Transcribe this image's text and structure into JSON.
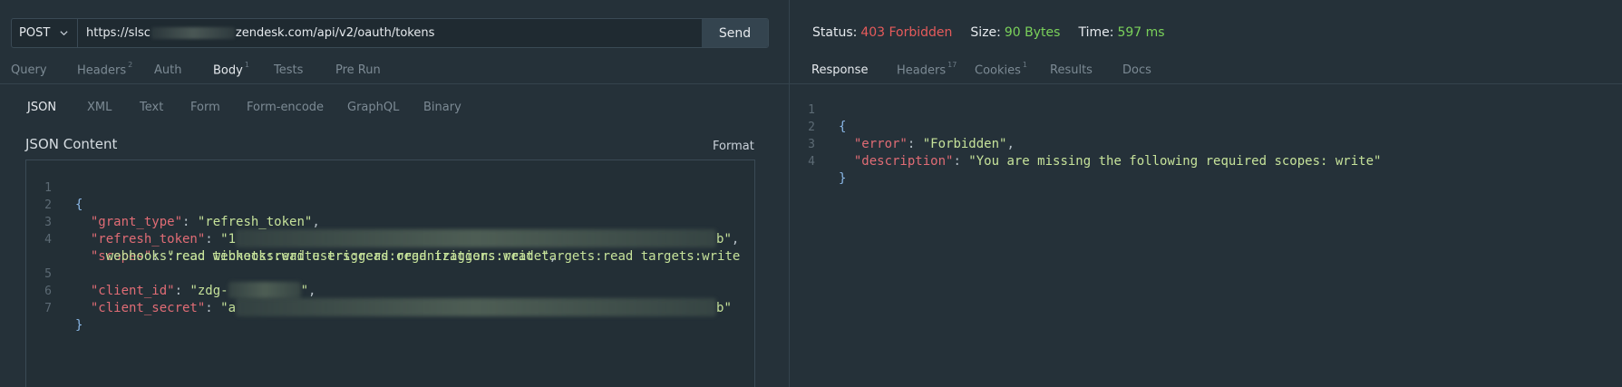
{
  "request": {
    "method": "POST",
    "url_prefix": "https://slsc",
    "url_suffix": "zendesk.com/api/v2/oauth/tokens",
    "send_label": "Send",
    "tabs": [
      {
        "label": "Query",
        "count": ""
      },
      {
        "label": "Headers",
        "count": "2"
      },
      {
        "label": "Auth",
        "count": ""
      },
      {
        "label": "Body",
        "count": "1"
      },
      {
        "label": "Tests",
        "count": ""
      },
      {
        "label": "Pre Run",
        "count": ""
      }
    ],
    "active_tab": "Body",
    "body_types": [
      "JSON",
      "XML",
      "Text",
      "Form",
      "Form-encode",
      "GraphQL",
      "Binary"
    ],
    "active_body_type": "JSON",
    "json_content_label": "JSON Content",
    "format_label": "Format",
    "lines": {
      "l1": "{",
      "l2_key": "\"grant_type\"",
      "l2_val": "\"refresh_token\"",
      "l3_key": "\"refresh_token\"",
      "l3_val_start": "\"1",
      "l3_val_end": "b\"",
      "l4_key": "\"scopes\"",
      "l4_val_a": "\"read tickets:read users:read organizations:read targets:read targets:write",
      "l4_val_b": "webhooks:read webhooks:write triggers:read triggers:write\"",
      "l5_key": "\"client_id\"",
      "l5_val_start": "\"zdg-",
      "l5_val_end": "\"",
      "l6_key": "\"client_secret\"",
      "l6_val_start": "\"a",
      "l6_val_end": "b\"",
      "l7": "}"
    },
    "line_numbers": [
      "1",
      "2",
      "3",
      "4",
      "5",
      "6",
      "7"
    ]
  },
  "response": {
    "status_label": "Status:",
    "status_value": "403 Forbidden",
    "size_label": "Size:",
    "size_value": "90 Bytes",
    "time_label": "Time:",
    "time_value": "597 ms",
    "tabs": [
      {
        "label": "Response",
        "count": ""
      },
      {
        "label": "Headers",
        "count": "17"
      },
      {
        "label": "Cookies",
        "count": "1"
      },
      {
        "label": "Results",
        "count": ""
      },
      {
        "label": "Docs",
        "count": ""
      }
    ],
    "active_tab": "Response",
    "lines": {
      "l1": "{",
      "l2_key": "\"error\"",
      "l2_val": "\"Forbidden\"",
      "l3_key": "\"description\"",
      "l3_val": "\"You are missing the following required scopes: write\"",
      "l4": "}"
    },
    "line_numbers": [
      "1",
      "2",
      "3",
      "4"
    ]
  },
  "colors": {
    "background": "#253139",
    "json_key": "#e06c75",
    "json_string": "#c6e29a",
    "status_error": "#e65b5b",
    "status_ok": "#7ad15a"
  },
  "icons": {
    "method_dropdown": "chevron-down-icon"
  }
}
